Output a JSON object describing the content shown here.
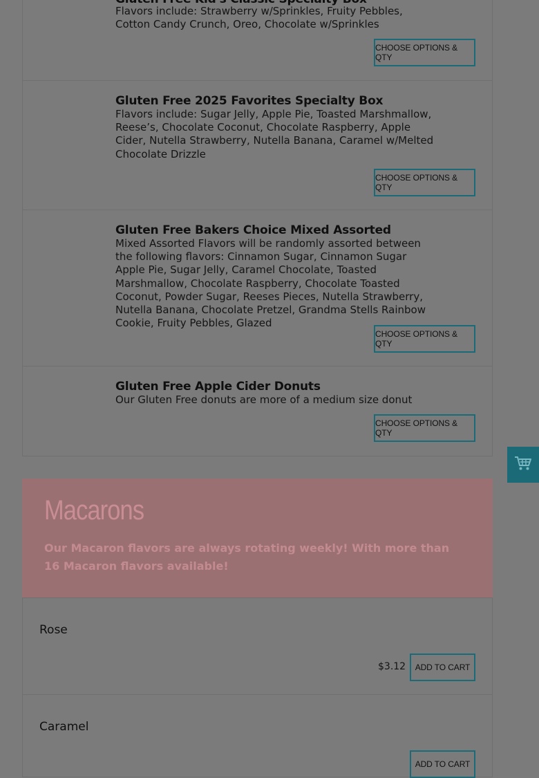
{
  "products": [
    {
      "title": "Gluten Free Kid's Classic Specialty Box",
      "description": "Flavors include: Strawberry w/Sprinkles, Fruity Pebbles, Cotton Candy Crunch, Oreo, Chocolate w/Sprinkles",
      "button": "Choose Options & Qty"
    },
    {
      "title": "Gluten Free 2025 Favorites Specialty Box",
      "description": "Flavors include: Sugar Jelly, Apple Pie, Toasted Marshmallow, Reese’s, Chocolate Coconut, Chocolate Raspberry, Apple Cider, Nutella Strawberry, Nutella Banana, Caramel w/Melted Chocolate Drizzle",
      "button": "Choose Options & Qty"
    },
    {
      "title": "Gluten Free Bakers Choice Mixed Assorted",
      "description": "Mixed Assorted Flavors will be randomly assorted between the following flavors: Cinnamon Sugar, Cinnamon Sugar Apple Pie, Sugar Jelly, Caramel Chocolate, Toasted Marshmallow, Chocolate Raspberry, Chocolate Toasted Coconut, Powder Sugar, Reeses Pieces, Nutella Strawberry, Nutella Banana, Chocolate Pretzel, Grandma Stells Rainbow Cookie, Fruity Pebbles, Glazed",
      "button": "Choose Options & Qty"
    },
    {
      "title": "Gluten Free Apple Cider Donuts",
      "description": "Our Gluten Free donuts are more of a medium size donut",
      "button": "Choose Options & Qty"
    }
  ],
  "macarons": {
    "title": "Macarons",
    "description": "Our Macaron flavors are always rotating weekly! With more than 16 Macaron flavors available!",
    "items": [
      {
        "name": "Rose",
        "price": "$3.12",
        "button": "Add to cart"
      },
      {
        "name": "Caramel",
        "price": "",
        "button": "Add to cart"
      }
    ]
  },
  "cart": {
    "icon": "shopping-cart-icon"
  },
  "colors": {
    "overlay_bg": "#7b7b7b",
    "accent": "#1a6a78",
    "macaron_banner": "#9b7073",
    "macaron_text": "#c88e94"
  }
}
